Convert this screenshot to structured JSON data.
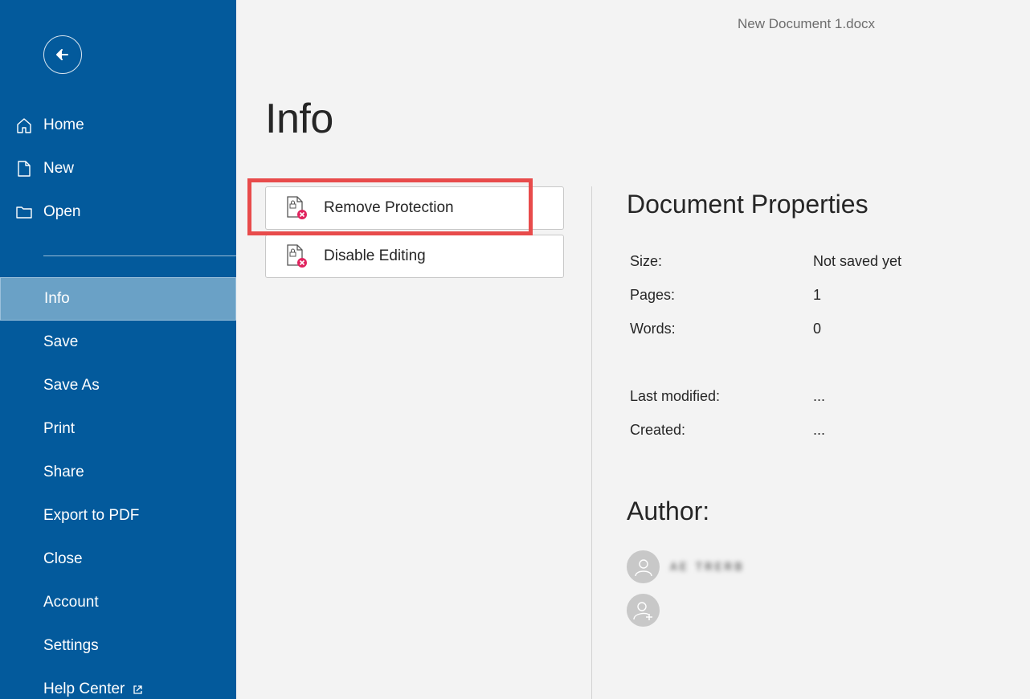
{
  "document": {
    "filename": "New Document 1.docx"
  },
  "sidebar": {
    "top_items": [
      {
        "label": "Home",
        "icon": "home-icon"
      },
      {
        "label": "New",
        "icon": "new-document-icon"
      },
      {
        "label": "Open",
        "icon": "folder-icon"
      }
    ],
    "items": [
      {
        "label": "Info",
        "active": true
      },
      {
        "label": "Save"
      },
      {
        "label": "Save As"
      },
      {
        "label": "Print"
      },
      {
        "label": "Share"
      },
      {
        "label": "Export to PDF"
      },
      {
        "label": "Close"
      },
      {
        "label": "Account"
      },
      {
        "label": "Settings"
      },
      {
        "label": "Help Center",
        "icon": "external-link-icon"
      }
    ]
  },
  "main": {
    "title": "Info",
    "actions": [
      {
        "label": "Remove Protection",
        "icon": "protected-document-icon",
        "highlighted": true
      },
      {
        "label": "Disable Editing",
        "icon": "protected-document-icon"
      }
    ]
  },
  "properties": {
    "title": "Document Properties",
    "rows": [
      {
        "label": "Size:",
        "value": "Not saved yet"
      },
      {
        "label": "Pages:",
        "value": "1"
      },
      {
        "label": "Words:",
        "value": "0"
      },
      {
        "label": "Last modified:",
        "value": "..."
      },
      {
        "label": "Created:",
        "value": "..."
      }
    ]
  },
  "author": {
    "title": "Author:",
    "name": "ᴀᴇ ᴛʀᴇʀʙ"
  },
  "colors": {
    "sidebar": "#035a9c",
    "active_item": "#6aa1c6",
    "highlight": "#e84b4b",
    "badge": "#e0245e"
  }
}
